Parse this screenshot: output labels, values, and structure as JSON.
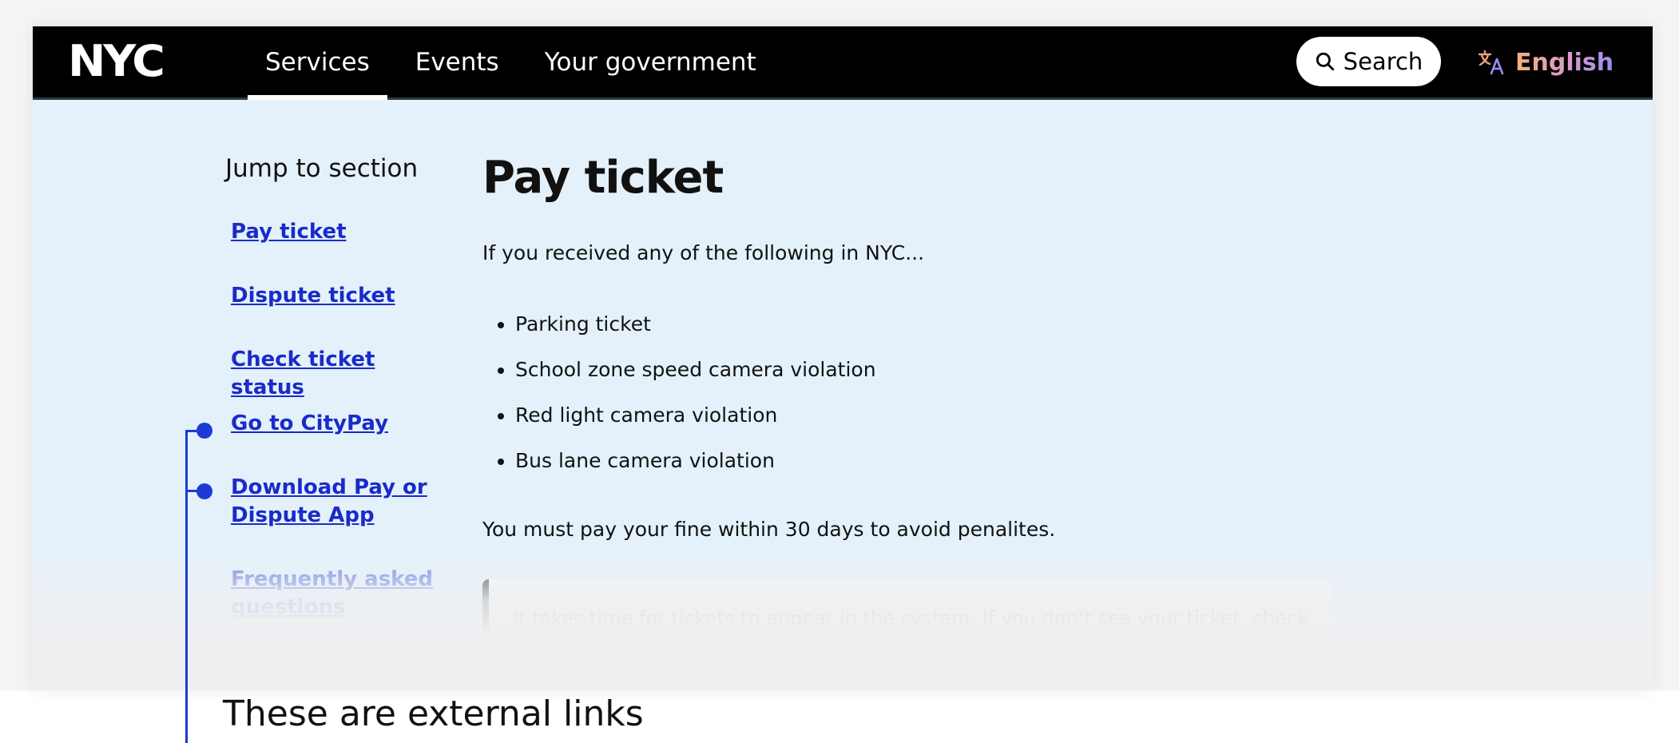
{
  "header": {
    "logo": "NYC",
    "nav": [
      {
        "label": "Services"
      },
      {
        "label": "Events"
      },
      {
        "label": "Your government"
      }
    ],
    "search_label": "Search",
    "language_label": "English"
  },
  "sidebar": {
    "title": "Jump to section",
    "items": [
      {
        "label": "Pay ticket"
      },
      {
        "label": "Dispute ticket"
      },
      {
        "label": "Check ticket status"
      },
      {
        "label": "Go to CityPay"
      },
      {
        "label": "Download Pay or Dispute App"
      },
      {
        "label": "Frequently asked questions"
      }
    ]
  },
  "main": {
    "title": "Pay ticket",
    "intro": "If you received any of the following in NYC...",
    "bullets": [
      "Parking ticket",
      "School zone speed camera violation",
      "Red light camera violation",
      "Bus lane camera violation"
    ],
    "deadline": "You must pay your fine within 30 days to avoid penalites.",
    "note": "It takes time for tickets to appear in the system. If you don’t see your ticket, check back in a few days. You can also pay in advance by entering your violation number"
  },
  "annotation": {
    "caption": "These are external links",
    "color": "#1b3bd4"
  },
  "colors": {
    "link": "#1a2bc9",
    "header_bg": "#000000",
    "content_bg": "#e4f1fa"
  }
}
